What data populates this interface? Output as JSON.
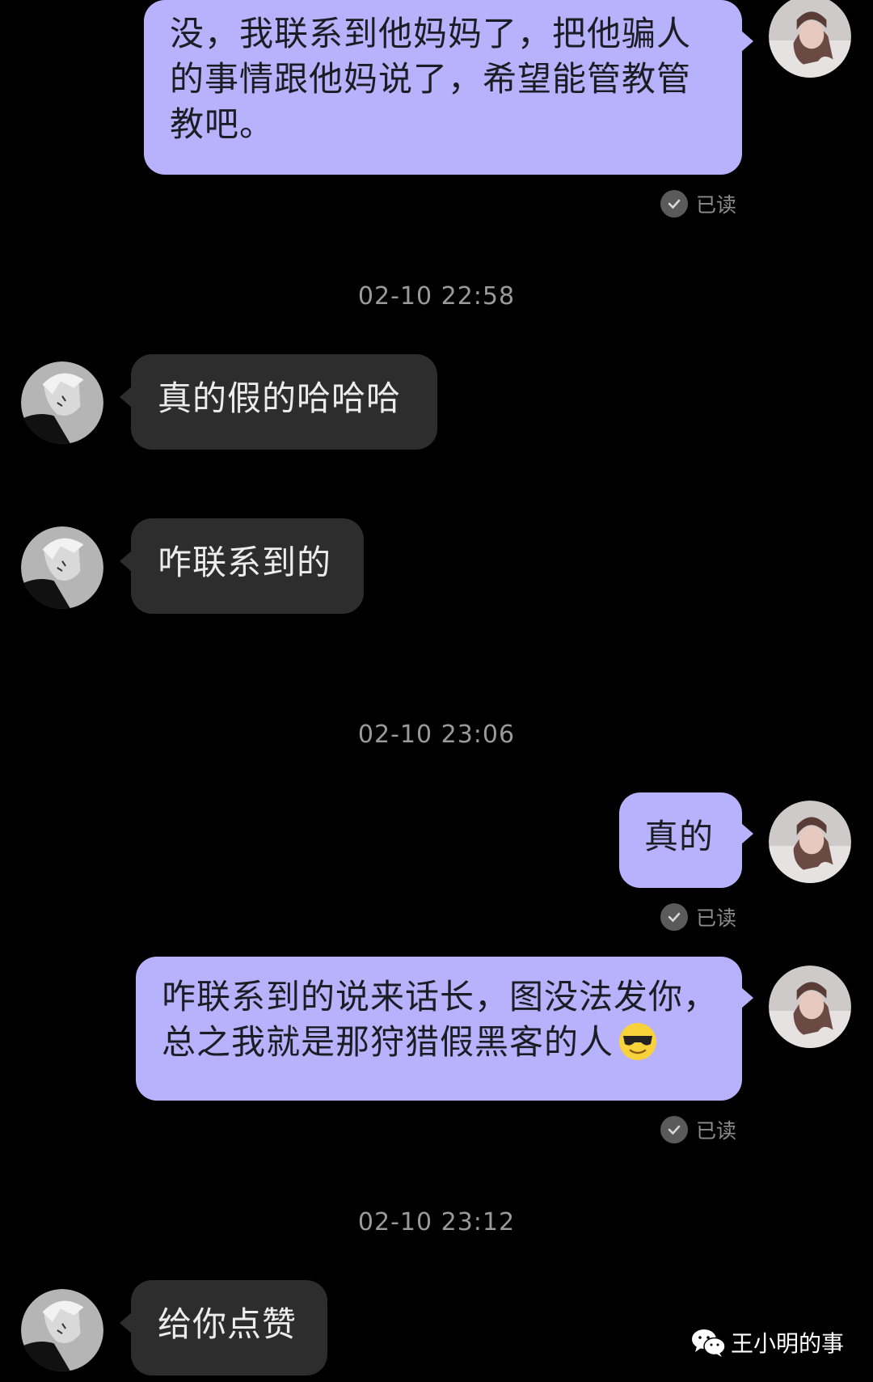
{
  "messages": {
    "m1": {
      "text": "没，我联系到他妈妈了，把他骗人的事情跟他妈说了，希望能管教管教吧。",
      "read": "已读"
    },
    "t1": "02-10   22:58",
    "m2": {
      "text": "真的假的哈哈哈"
    },
    "m3": {
      "text": "咋联系到的"
    },
    "t2": "02-10   23:06",
    "m4": {
      "text": "真的",
      "read": "已读"
    },
    "m5": {
      "text": "咋联系到的说来话长，图没法发你，总之我就是那狩猎假黑客的人",
      "emoji": "cool-sunglasses-emoji",
      "read": "已读"
    },
    "t3": "02-10   23:12",
    "m6": {
      "text": "给你点赞"
    }
  },
  "watermark": {
    "label": "王小明的事",
    "icon": "wechat-icon"
  },
  "colors": {
    "background": "#000000",
    "outgoing_bubble": "#b7b2fb",
    "incoming_bubble": "#2d2d2d",
    "timestamp": "#9a9a9a"
  }
}
